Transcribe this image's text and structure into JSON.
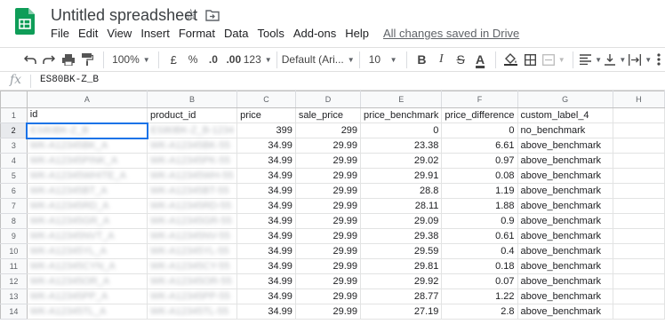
{
  "header": {
    "title": "Untitled spreadsheet",
    "menus": [
      "File",
      "Edit",
      "View",
      "Insert",
      "Format",
      "Data",
      "Tools",
      "Add-ons",
      "Help"
    ],
    "saved_status": "All changes saved in Drive"
  },
  "toolbar": {
    "zoom": "100%",
    "currency": "£",
    "percent": "%",
    "decrease_decimals": ".0",
    "increase_decimals": ".00",
    "more_formats": "123",
    "font": "Default (Ari...",
    "font_size": "10",
    "bold": "B",
    "italic": "I",
    "strikethrough": "S",
    "text_color": "A"
  },
  "formula_bar": {
    "fx": "fx",
    "value": "ES80BK-Z_B"
  },
  "grid": {
    "column_letters": [
      "A",
      "B",
      "C",
      "D",
      "E",
      "F",
      "G",
      "H"
    ],
    "headers": [
      "id",
      "product_id",
      "price",
      "sale_price",
      "price_benchmark",
      "price_difference",
      "custom_label_4"
    ],
    "rows": [
      {
        "n": "2",
        "id": "ES80BK-Z_B",
        "product_id": "ES80BK-Z_B-1234",
        "price": "399",
        "sale_price": "299",
        "price_benchmark": "0",
        "price_difference": "0",
        "label": "no_benchmark"
      },
      {
        "n": "3",
        "id": "WK-A12345BK_A",
        "product_id": "WK-A12345BK-55",
        "price": "34.99",
        "sale_price": "29.99",
        "price_benchmark": "23.38",
        "price_difference": "6.61",
        "label": "above_benchmark"
      },
      {
        "n": "4",
        "id": "WK-A12345PINK_A",
        "product_id": "WK-A12345PK-55",
        "price": "34.99",
        "sale_price": "29.99",
        "price_benchmark": "29.02",
        "price_difference": "0.97",
        "label": "above_benchmark"
      },
      {
        "n": "5",
        "id": "WK-A12345WHITE_A",
        "product_id": "WK-A12345WH-55",
        "price": "34.99",
        "sale_price": "29.99",
        "price_benchmark": "29.91",
        "price_difference": "0.08",
        "label": "above_benchmark"
      },
      {
        "n": "6",
        "id": "WK-A12345BT_A",
        "product_id": "WK-A12345BT-55",
        "price": "34.99",
        "sale_price": "29.99",
        "price_benchmark": "28.8",
        "price_difference": "1.19",
        "label": "above_benchmark"
      },
      {
        "n": "7",
        "id": "WK-A12345RD_A",
        "product_id": "WK-A12345RD-55",
        "price": "34.99",
        "sale_price": "29.99",
        "price_benchmark": "28.11",
        "price_difference": "1.88",
        "label": "above_benchmark"
      },
      {
        "n": "8",
        "id": "WK-A12345GR_A",
        "product_id": "WK-A12345GR-55",
        "price": "34.99",
        "sale_price": "29.99",
        "price_benchmark": "29.09",
        "price_difference": "0.9",
        "label": "above_benchmark"
      },
      {
        "n": "9",
        "id": "WK-A12345NVT_A",
        "product_id": "WK-A12345NV-55",
        "price": "34.99",
        "sale_price": "29.99",
        "price_benchmark": "29.38",
        "price_difference": "0.61",
        "label": "above_benchmark"
      },
      {
        "n": "10",
        "id": "WK-A12345YL_A",
        "product_id": "WK-A12345YL-55",
        "price": "34.99",
        "sale_price": "29.99",
        "price_benchmark": "29.59",
        "price_difference": "0.4",
        "label": "above_benchmark"
      },
      {
        "n": "11",
        "id": "WK-A12345CYN_A",
        "product_id": "WK-A12345CY-55",
        "price": "34.99",
        "sale_price": "29.99",
        "price_benchmark": "29.81",
        "price_difference": "0.18",
        "label": "above_benchmark"
      },
      {
        "n": "12",
        "id": "WK-A12345OR_A",
        "product_id": "WK-A12345OR-55",
        "price": "34.99",
        "sale_price": "29.99",
        "price_benchmark": "29.92",
        "price_difference": "0.07",
        "label": "above_benchmark"
      },
      {
        "n": "13",
        "id": "WK-A12345PP_A",
        "product_id": "WK-A12345PP-55",
        "price": "34.99",
        "sale_price": "29.99",
        "price_benchmark": "28.77",
        "price_difference": "1.22",
        "label": "above_benchmark"
      },
      {
        "n": "14",
        "id": "WK-A12345TL_A",
        "product_id": "WK-A12345TL-55",
        "price": "34.99",
        "sale_price": "29.99",
        "price_benchmark": "27.19",
        "price_difference": "2.8",
        "label": "above_benchmark"
      }
    ]
  },
  "colors": {
    "logo_green": "#0f9d58",
    "selection_blue": "#1a73e8"
  }
}
